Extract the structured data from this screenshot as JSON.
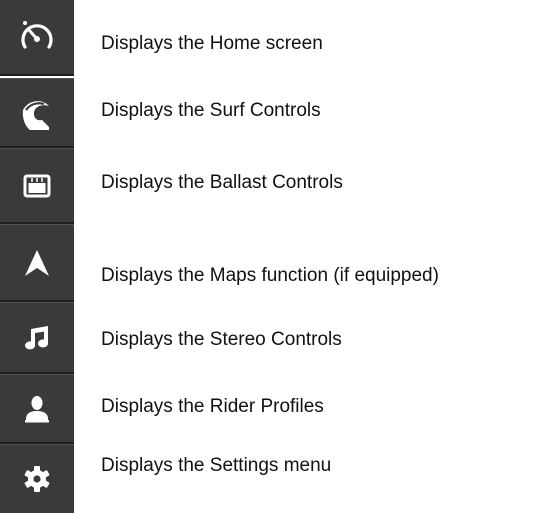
{
  "items": [
    {
      "icon": "speedometer-icon",
      "label": "Displays the Home screen"
    },
    {
      "icon": "wave-icon",
      "label": "Displays the Surf Controls"
    },
    {
      "icon": "ballast-tank-icon",
      "label": "Displays the Ballast Controls"
    },
    {
      "icon": "navigation-arrow-icon",
      "label": "Displays the Maps function (if equipped)"
    },
    {
      "icon": "music-note-icon",
      "label": "Displays the Stereo Controls"
    },
    {
      "icon": "person-icon",
      "label": "Displays the Rider Profiles"
    },
    {
      "icon": "gear-icon",
      "label": "Displays the Settings menu"
    }
  ],
  "colors": {
    "tile_background": "#3a3a3a",
    "icon_color": "#ffffff",
    "text_color": "#111111"
  }
}
